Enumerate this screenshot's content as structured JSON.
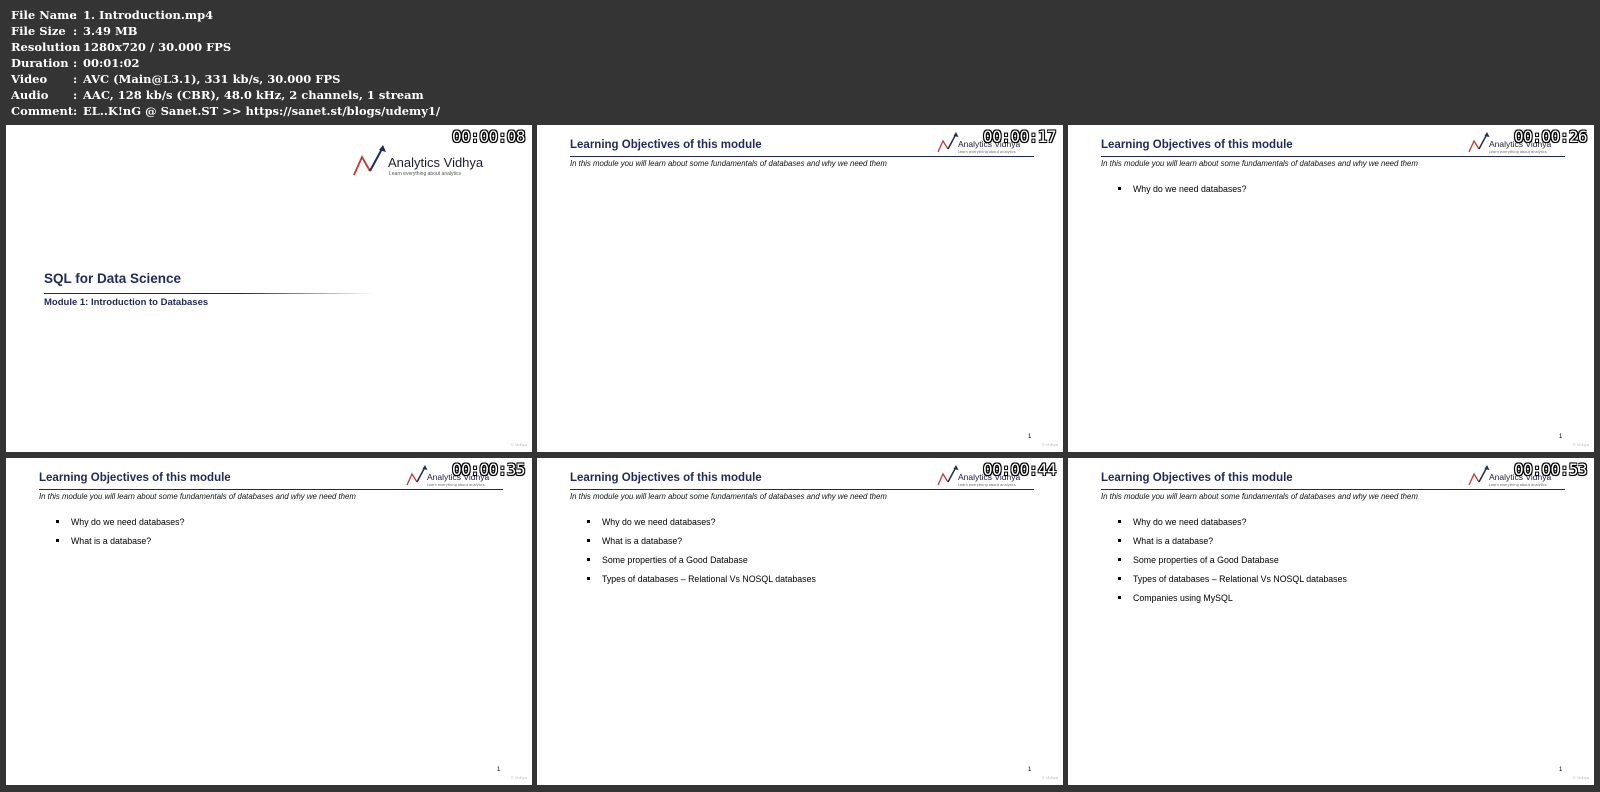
{
  "meta": [
    {
      "key": "File Name",
      "sep": ":",
      "value": "1. Introduction.mp4"
    },
    {
      "key": "File Size",
      "sep": ":",
      "value": "3.49 MB"
    },
    {
      "key": "Resolution",
      "sep": ":",
      "value": "1280x720 / 30.000 FPS"
    },
    {
      "key": "Duration",
      "sep": ":",
      "value": "00:01:02"
    },
    {
      "key": "Video",
      "sep": ":",
      "value": "AVC (Main@L3.1), 331 kb/s, 30.000 FPS"
    },
    {
      "key": "Audio",
      "sep": ":",
      "value": "AAC, 128 kb/s (CBR), 48.0 kHz, 2 channels, 1 stream"
    },
    {
      "key": "Comment",
      "sep": ":",
      "value": "EL..K!nG @ Sanet.ST  >> https://sanet.st/blogs/udemy1/"
    }
  ],
  "logo": {
    "name": "Analytics Vidhya",
    "tagline": "Learn everything about analytics"
  },
  "title_slide": {
    "timestamp": "00:00:08",
    "title": "SQL for Data Science",
    "subtitle": "Module 1: Introduction to Databases",
    "watermark": "© Vidhya"
  },
  "objectives": {
    "title": "Learning Objectives of this module",
    "subtitle": "In this module you will learn about some fundamentals of databases and why we need them",
    "page_number": "1",
    "watermark": "© Vidhya",
    "items": [
      "Why do we need databases?",
      "What is a database?",
      "Some properties of a Good Database",
      "Types of databases – Relational Vs NOSQL databases",
      "Companies using MySQL"
    ]
  },
  "thumbs": [
    {
      "timestamp": "00:00:17",
      "visible_count": 0
    },
    {
      "timestamp": "00:00:26",
      "visible_count": 1
    },
    {
      "timestamp": "00:00:35",
      "visible_count": 2
    },
    {
      "timestamp": "00:00:44",
      "visible_count": 4
    },
    {
      "timestamp": "00:00:53",
      "visible_count": 5
    }
  ],
  "colors": {
    "background": "#343434",
    "slide_title": "#1f2a5c",
    "logo_red": "#c0392b",
    "logo_navy": "#1c2d5a"
  }
}
